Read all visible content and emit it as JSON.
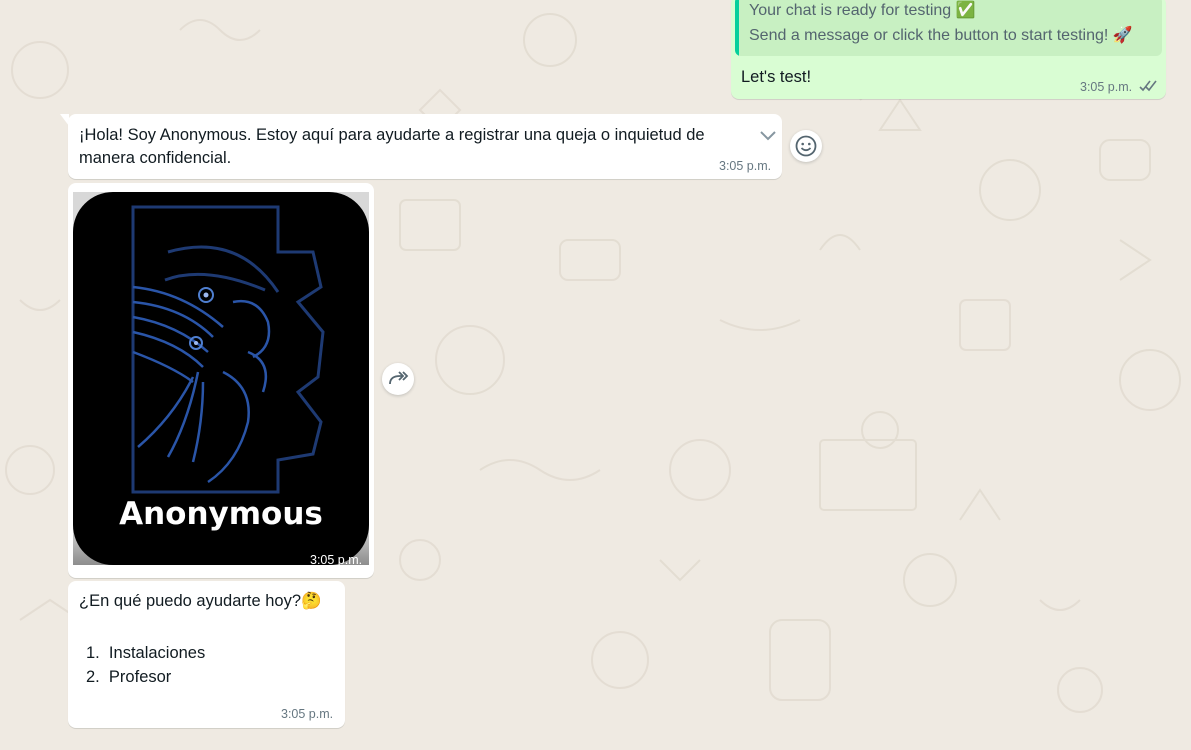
{
  "colors": {
    "wallpaper": "#efeae2",
    "outgoing_bubble": "#d9fdd3",
    "incoming_bubble": "#ffffff",
    "quote_bar": "#06cf9c",
    "quote_bg": "#c8f0c2",
    "timestamp": "#667781",
    "read_ticks": "#667781"
  },
  "outgoing": {
    "quote_line1": "Your chat is ready for testing ✅",
    "quote_line2": "Send a message or click the button to start testing! 🚀",
    "text": "Let's test!",
    "time": "3:05 p.m.",
    "status_icon": "double-check-icon"
  },
  "greeting": {
    "text_line1": "¡Hola! Soy Anonymous. Estoy aquí para ayudarte a registrar una queja o inquietud de",
    "text_line2": "manera confidencial.",
    "time": "3:05 p.m.",
    "menu_icon": "chevron-down-icon",
    "reaction_icon": "smiley-icon"
  },
  "image_message": {
    "caption": "Anonymous",
    "time": "3:05 p.m.",
    "forward_icon": "forward-icon"
  },
  "question": {
    "text": "¿En qué puedo ayudarte hoy?🤔",
    "options": [
      "1.  Instalaciones",
      "2.  Profesor"
    ],
    "time": "3:05 p.m."
  }
}
